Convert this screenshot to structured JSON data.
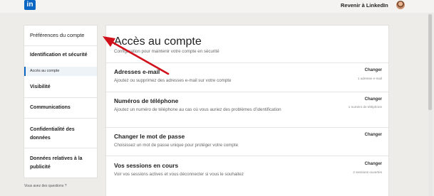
{
  "header": {
    "logo_text": "in",
    "back_link": "Revenir à LinkedIn"
  },
  "sidebar": {
    "preferences": "Préférences du compte",
    "identification": "Identification et sécurité",
    "account_access": "Accès au compte",
    "visibility": "Visibilité",
    "communications": "Communications",
    "data_privacy": "Confidentialité des données",
    "advertising_data": "Données relatives à la publicité"
  },
  "footer": {
    "questions": "Vous avez des questions ?"
  },
  "main": {
    "title": "Accès au compte",
    "subtitle": "Configuration pour maintenir votre compte en sécurité",
    "rows": [
      {
        "title": "Adresses e-mail",
        "desc": "Ajoutez ou supprimez des adresses e-mail sur votre compte",
        "action": "Changer",
        "meta": "1 adresse e-mail"
      },
      {
        "title": "Numéros de téléphone",
        "desc": "Ajoutez un numéro de téléphone au cas où vous auriez des problèmes d’identification",
        "action": "Changer",
        "meta": "1 numéro de téléphone"
      },
      {
        "title": "Changer le mot de passe",
        "desc": "Choisissez un mot de passe unique pour protéger votre compte",
        "action": "Changer",
        "meta": ""
      },
      {
        "title": "Vos sessions en cours",
        "desc": "Voir vos sessions actives et vous déconnecter si vous le souhaitez",
        "action": "Changer",
        "meta": "2 sessions ouvertes"
      }
    ]
  },
  "colors": {
    "brand": "#0a66c2",
    "annotation_arrow": "#d0101a"
  }
}
